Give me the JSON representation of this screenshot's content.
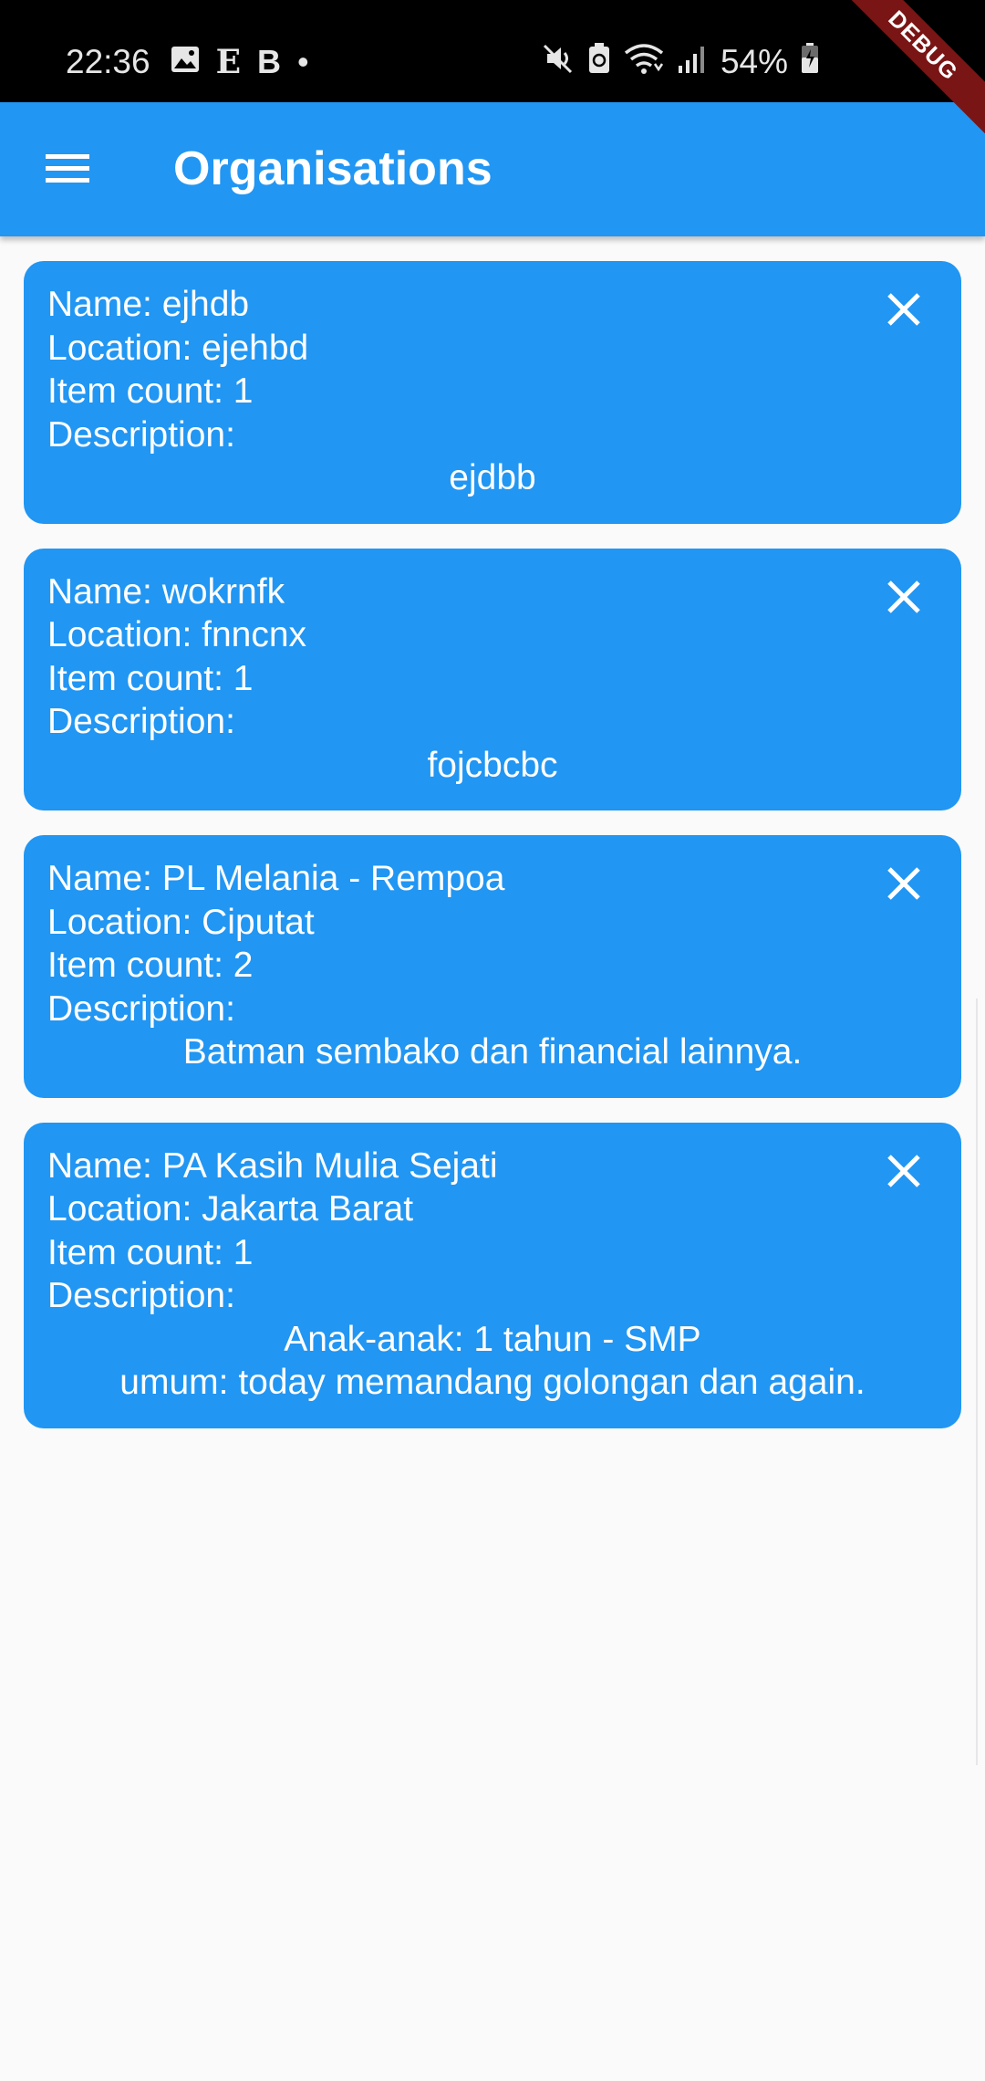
{
  "status_bar": {
    "time": "22:36",
    "left_icons": [
      "image-icon",
      "e-icon",
      "b-icon",
      "dot-icon"
    ],
    "e_glyph": "E",
    "b_glyph": "B",
    "dot_glyph": "•",
    "right_icons": [
      "mute-icon",
      "battery-saver-icon",
      "wifi-icon",
      "signal-icon",
      "battery-icon"
    ],
    "battery_percent": "54%"
  },
  "debug_banner": "DEBUG",
  "app_bar": {
    "menu_icon": "menu-icon",
    "title": "Organisations",
    "color": "#2196f3"
  },
  "organisations": [
    {
      "name_line": "Name: ejhdb",
      "location_line": "Location: ejehbd",
      "item_count_line": "Item count: 1",
      "description_label": "Description:",
      "description": "ejdbb"
    },
    {
      "name_line": "Name: wokrnfk",
      "location_line": "Location: fnncnx",
      "item_count_line": "Item count: 1",
      "description_label": "Description:",
      "description": "fojcbcbc"
    },
    {
      "name_line": "Name: PL Melania - Rempoa",
      "location_line": "Location: Ciputat",
      "item_count_line": "Item count: 2",
      "description_label": "Description:",
      "description": "Batman sembako dan financial lainnya."
    },
    {
      "name_line": "Name: PA Kasih Mulia Sejati",
      "location_line": "Location: Jakarta Barat",
      "item_count_line": "Item count: 1",
      "description_label": "Description:",
      "description": "Anak-anak: 1 tahun - SMP\numum: today memandang golongan dan again."
    }
  ],
  "close_icon": "close-icon"
}
